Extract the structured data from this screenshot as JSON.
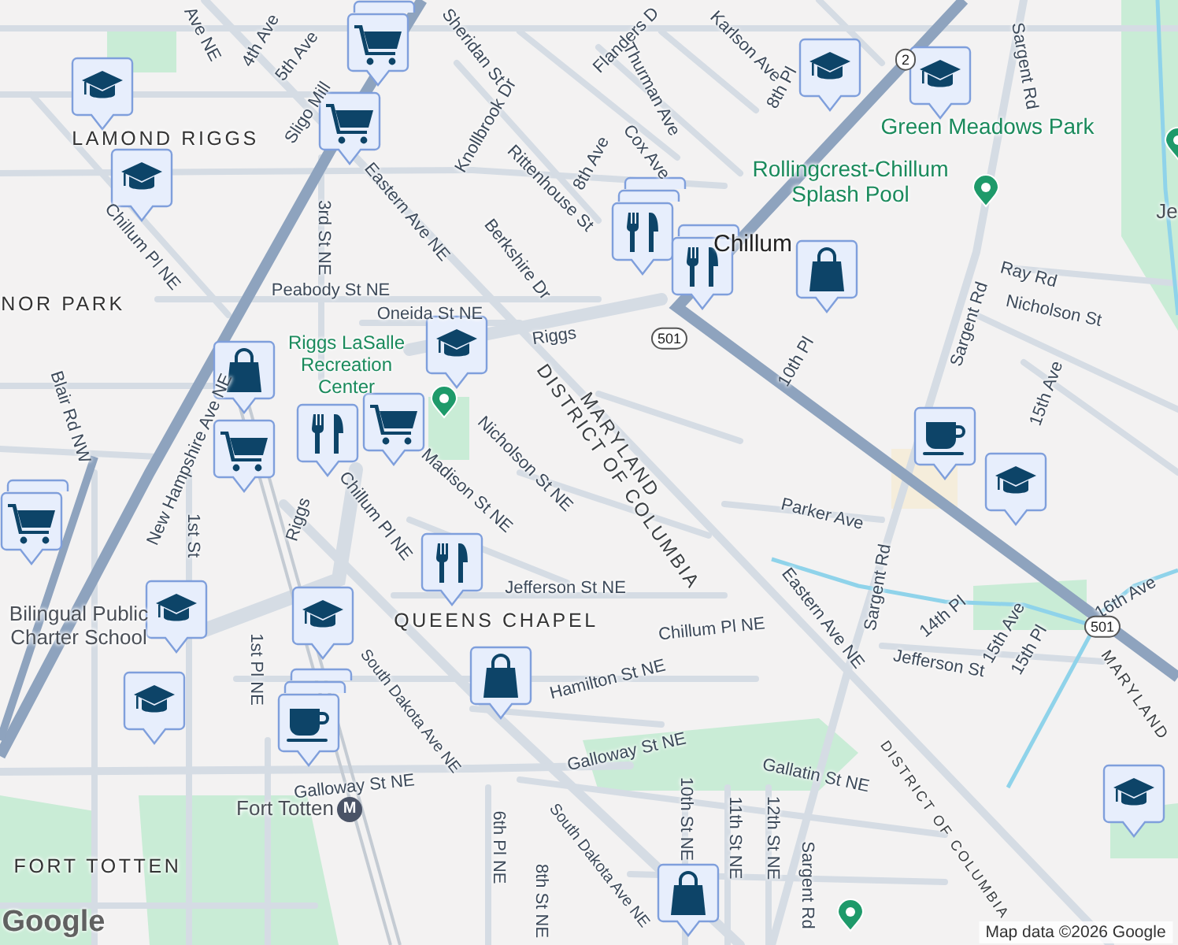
{
  "labels": [
    {
      "kind": "street",
      "text": "Ave NE"
    },
    {
      "kind": "street",
      "text": "4th Ave"
    },
    {
      "kind": "street",
      "text": "5th Ave"
    },
    {
      "kind": "street",
      "text": "Sligo Mill"
    },
    {
      "kind": "street",
      "text": "Sheridan St"
    },
    {
      "kind": "street",
      "text": "Knollbrook Dr"
    },
    {
      "kind": "street",
      "text": "Flanders D"
    },
    {
      "kind": "street",
      "text": "Karlson Ave"
    },
    {
      "kind": "street",
      "text": "Thurman Ave"
    },
    {
      "kind": "street",
      "text": "Cox Ave"
    },
    {
      "kind": "street",
      "text": "8th Ave"
    },
    {
      "kind": "street",
      "text": "Rittenhouse St"
    },
    {
      "kind": "street",
      "text": "8th Pl"
    },
    {
      "kind": "street",
      "text": "Eastern Ave NE"
    },
    {
      "kind": "street",
      "text": "3rd St NE"
    },
    {
      "kind": "street",
      "text": "Berkshire Dr"
    },
    {
      "kind": "street",
      "text": "Chillum Pl NE"
    },
    {
      "kind": "street",
      "text": "Peabody St NE"
    },
    {
      "kind": "street",
      "text": "Oneida St NE"
    },
    {
      "kind": "street",
      "text": "Riggs"
    },
    {
      "kind": "street",
      "text": "Blair Rd NW"
    },
    {
      "kind": "street",
      "text": "New Hampshire Ave NE"
    },
    {
      "kind": "street",
      "text": "Nicholson St NE"
    },
    {
      "kind": "street",
      "text": "Madison St NE"
    },
    {
      "kind": "street",
      "text": "Chillum Pl NE"
    },
    {
      "kind": "street",
      "text": "Riggs"
    },
    {
      "kind": "street",
      "text": "1st St"
    },
    {
      "kind": "street",
      "text": "1st Pl NE"
    },
    {
      "kind": "street",
      "text": "South Dakota Ave NE"
    },
    {
      "kind": "street",
      "text": "Jefferson St NE"
    },
    {
      "kind": "street",
      "text": "Hamilton St NE"
    },
    {
      "kind": "street",
      "text": "Galloway St NE"
    },
    {
      "kind": "street",
      "text": "Galloway St NE"
    },
    {
      "kind": "street",
      "text": "Gallatin St NE"
    },
    {
      "kind": "street",
      "text": "6th Pl NE"
    },
    {
      "kind": "street",
      "text": "South Dakota Ave NE"
    },
    {
      "kind": "street",
      "text": "8th St NE"
    },
    {
      "kind": "street",
      "text": "10th St NE"
    },
    {
      "kind": "street",
      "text": "11th St NE"
    },
    {
      "kind": "street",
      "text": "12th St NE"
    },
    {
      "kind": "street",
      "text": "Sargent Rd"
    },
    {
      "kind": "street",
      "text": "Eastern Ave NE"
    },
    {
      "kind": "street",
      "text": "Chillum Pl NE"
    },
    {
      "kind": "street",
      "text": "Parker Ave"
    },
    {
      "kind": "street",
      "text": "Sargent Rd"
    },
    {
      "kind": "street",
      "text": "10th Pl"
    },
    {
      "kind": "street",
      "text": "Sargent Rd"
    },
    {
      "kind": "street",
      "text": "Sargent Rd"
    },
    {
      "kind": "street",
      "text": "Ray Rd"
    },
    {
      "kind": "street",
      "text": "Nicholson St"
    },
    {
      "kind": "street",
      "text": "15th Ave"
    },
    {
      "kind": "street",
      "text": "14th Pl"
    },
    {
      "kind": "street",
      "text": "15th Ave"
    },
    {
      "kind": "street",
      "text": "15th Pl"
    },
    {
      "kind": "street",
      "text": "Jefferson St"
    },
    {
      "kind": "street",
      "text": "16th Ave"
    },
    {
      "kind": "border",
      "text": "MARYLAND"
    },
    {
      "kind": "border",
      "text": "DISTRICT OF COLUMBIA"
    },
    {
      "kind": "border",
      "text": "MARYLAND"
    },
    {
      "kind": "border",
      "text": "DISTRICT OF COLUMBIA"
    },
    {
      "kind": "area",
      "text": "LAMOND RIGGS"
    },
    {
      "kind": "area",
      "text": "NOR PARK"
    },
    {
      "kind": "area",
      "text": "QUEENS CHAPEL"
    },
    {
      "kind": "area",
      "text": "FORT TOTTEN"
    },
    {
      "kind": "place",
      "text": "Chillum"
    },
    {
      "kind": "park",
      "text": "Green Meadows Park"
    },
    {
      "kind": "park",
      "text": "Rollingcrest-Chillum Splash Pool"
    },
    {
      "kind": "park",
      "text": "Riggs LaSalle Recreation Center"
    },
    {
      "kind": "poi",
      "text": "Bilingual Public Charter School"
    },
    {
      "kind": "poi",
      "text": "Fort Totten"
    },
    {
      "kind": "metro",
      "text": "M"
    },
    {
      "kind": "poi",
      "text": "Je"
    },
    {
      "kind": "route",
      "text": "501"
    },
    {
      "kind": "route",
      "text": "501"
    },
    {
      "kind": "route",
      "text": "2"
    },
    {
      "kind": "logo",
      "text": "Google"
    },
    {
      "kind": "attribution",
      "text": "Map data ©2026 Google"
    }
  ],
  "markers": [
    {
      "kind": "school",
      "stacked": false
    },
    {
      "kind": "school",
      "stacked": false
    },
    {
      "kind": "school",
      "stacked": false
    },
    {
      "kind": "school",
      "stacked": false
    },
    {
      "kind": "school",
      "stacked": false
    },
    {
      "kind": "school",
      "stacked": false
    },
    {
      "kind": "school",
      "stacked": false
    },
    {
      "kind": "school",
      "stacked": false
    },
    {
      "kind": "school",
      "stacked": false
    },
    {
      "kind": "school",
      "stacked": false
    },
    {
      "kind": "cart",
      "stacked": false
    },
    {
      "kind": "cart",
      "stacked": false
    },
    {
      "kind": "cart",
      "stacked": false
    },
    {
      "kind": "cart",
      "stacked": false
    },
    {
      "kind": "cart",
      "stacked": false
    },
    {
      "kind": "shop",
      "stacked": false
    },
    {
      "kind": "shop",
      "stacked": false
    },
    {
      "kind": "shop",
      "stacked": false
    },
    {
      "kind": "shop",
      "stacked": false
    },
    {
      "kind": "food",
      "stacked": false
    },
    {
      "kind": "food",
      "stacked": false
    },
    {
      "kind": "food",
      "stacked": false
    },
    {
      "kind": "food",
      "stacked": false
    },
    {
      "kind": "coffee",
      "stacked": false
    },
    {
      "kind": "coffee",
      "stacked": false
    },
    {
      "kind": "park",
      "stacked": false
    },
    {
      "kind": "park",
      "stacked": false
    },
    {
      "kind": "park",
      "stacked": false
    },
    {
      "kind": "park",
      "stacked": false
    },
    {
      "kind": "cart",
      "stacked": true
    },
    {
      "kind": "cart",
      "stacked": true
    },
    {
      "kind": "food",
      "stacked": true
    },
    {
      "kind": "food",
      "stacked": true
    },
    {
      "kind": "food",
      "stacked": true
    },
    {
      "kind": "coffee",
      "stacked": true
    },
    {
      "kind": "coffee",
      "stacked": true
    }
  ]
}
